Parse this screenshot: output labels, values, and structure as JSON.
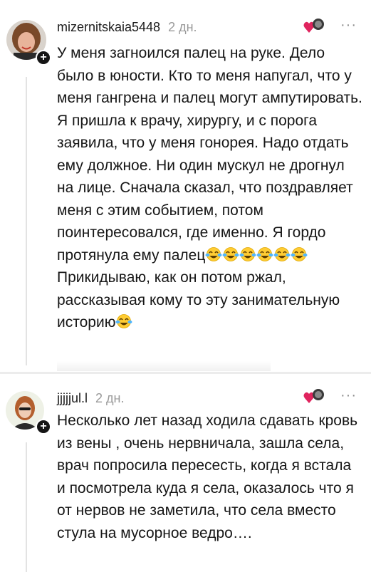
{
  "comments": [
    {
      "username": "mizernitskaia5448",
      "time": "2 дн.",
      "more_label": "···",
      "text": "У меня загноился палец на руке. Дело было в юности. Кто то меня напугал, что у меня гангрена и палец могут ампутировать. Я пришла к врачу, хирургу, и с порога заявила, что у меня гонорея. Надо отдать ему должное. Ни один мускул не дрогнул на лице. Сначала сказал, что поздравляет меня с этим событием, потом поинтересовался, где именно. Я гордо протянула ему палец",
      "text_tail_1": "Прикидываю, как он потом ржал, рассказывая кому то эту занимательную историю",
      "emoji_name": "face-with-tears-of-joy",
      "emoji_count_1": 6,
      "emoji_count_2": 1
    },
    {
      "username": "jjjjjul.l",
      "time": "2 дн.",
      "more_label": "···",
      "text": "Несколько лет назад ходила сдавать кровь из вены , очень нервничала, зашла села, врач попросила пересесть, когда я встала и посмотрела куда я села, оказалось что я от нервов не заметила, что села вместо стула на мусорное ведро…."
    }
  ],
  "badge_label": "+",
  "colors": {
    "text": "#161616",
    "muted": "#9a9a9a",
    "heart": "#e0245e"
  },
  "icons": [
    "avatar",
    "plus-icon",
    "heart-reaction-icon",
    "more-icon",
    "face-with-tears-of-joy-emoji"
  ]
}
